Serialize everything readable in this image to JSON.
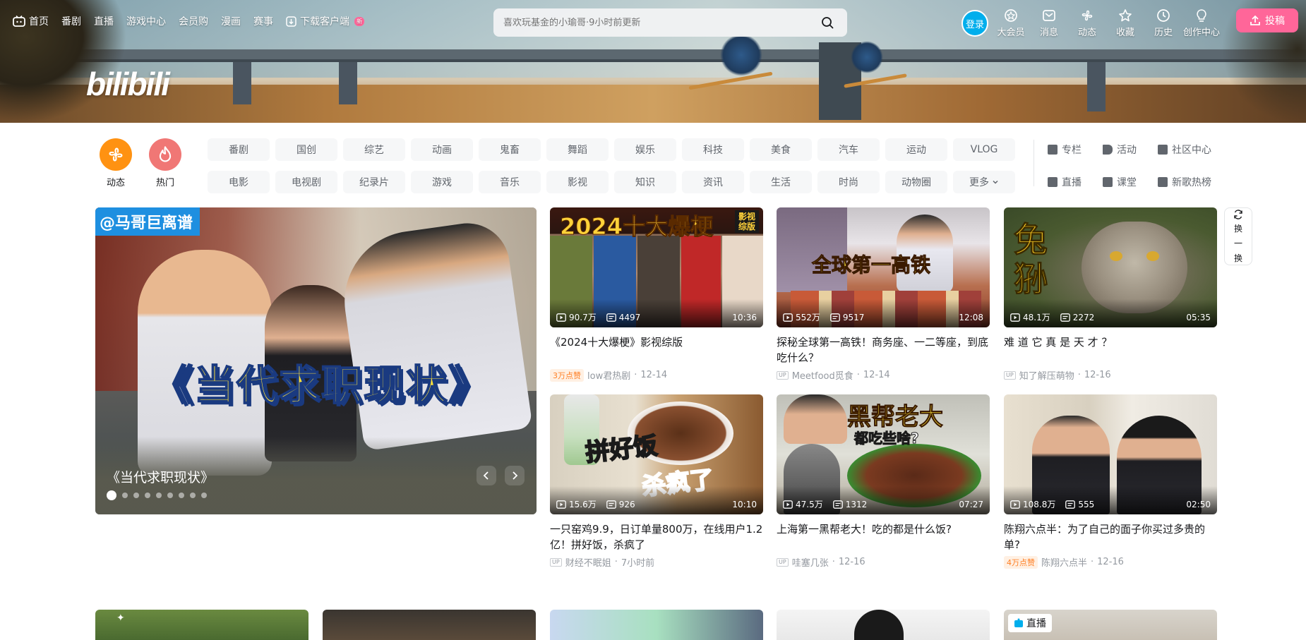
{
  "nav": {
    "left_items": [
      {
        "label": "首页",
        "icon": "tv-icon"
      },
      {
        "label": "番剧"
      },
      {
        "label": "直播"
      },
      {
        "label": "游戏中心"
      },
      {
        "label": "会员购"
      },
      {
        "label": "漫画"
      },
      {
        "label": "赛事"
      },
      {
        "label": "下载客户端",
        "icon": "download-icon",
        "badge": "新"
      }
    ],
    "search_placeholder": "喜欢玩基金的小瑜哥·9小时前更新",
    "login_label": "登录",
    "right_items": [
      {
        "label": "大会员",
        "icon": "vip-icon"
      },
      {
        "label": "消息",
        "icon": "message-icon"
      },
      {
        "label": "动态",
        "icon": "dynamic-icon"
      },
      {
        "label": "收藏",
        "icon": "star-icon"
      },
      {
        "label": "历史",
        "icon": "clock-icon"
      },
      {
        "label": "创作中心",
        "icon": "bulb-icon"
      }
    ],
    "upload_label": "投稿"
  },
  "logo": "bilibili",
  "channels": {
    "big": [
      {
        "label": "动态",
        "color": "#ff9212"
      },
      {
        "label": "热门",
        "color": "#f07775"
      }
    ],
    "grid": [
      "番剧",
      "国创",
      "综艺",
      "动画",
      "鬼畜",
      "舞蹈",
      "娱乐",
      "科技",
      "美食",
      "汽车",
      "运动",
      "VLOG",
      "电影",
      "电视剧",
      "纪录片",
      "游戏",
      "音乐",
      "影视",
      "知识",
      "资讯",
      "生活",
      "时尚",
      "动物圈",
      "更多"
    ],
    "side": [
      "专栏",
      "活动",
      "社区中心",
      "直播",
      "课堂",
      "新歌热榜"
    ]
  },
  "hero": {
    "tag": "@马哥巨离谱",
    "big_title": "《当代求职现状》",
    "caption": "《当代求职现状》",
    "dot_count": 9
  },
  "refresh": {
    "lines": [
      "换",
      "一",
      "换"
    ]
  },
  "cards": [
    {
      "views": "90.7万",
      "danmaku": "4497",
      "duration": "10:36",
      "title": "《2024十大爆梗》影视综版",
      "likes": "3万点赞",
      "author": "low君热剧",
      "date": "12-14",
      "thumb_text": "2024十大爆梗",
      "thumb_sub": "影视综版"
    },
    {
      "views": "552万",
      "danmaku": "9517",
      "duration": "12:08",
      "title": "探秘全球第一高铁！商务座、一二等座，到底吃什么？",
      "up": "UP",
      "author": "Meetfood觅食",
      "date": "12-14",
      "thumb_text": "全球第一高铁"
    },
    {
      "views": "48.1万",
      "danmaku": "2272",
      "duration": "05:35",
      "title": "难 道 它 真 是 天 才 ？",
      "up": "UP",
      "author": "知了解压萌物",
      "date": "12-16",
      "thumb_text": "兔狲"
    },
    {
      "views": "15.6万",
      "danmaku": "926",
      "duration": "10:10",
      "title": "一只窑鸡9.9，日订单量800万，在线用户1.2亿！拼好饭，杀疯了",
      "up": "UP",
      "author": "财经不眠姐",
      "date": "7小时前",
      "thumb_text": "拼好饭",
      "thumb_sub": "杀疯了"
    },
    {
      "views": "47.5万",
      "danmaku": "1312",
      "duration": "07:27",
      "title": "上海第一黑帮老大！吃的都是什么饭?",
      "up": "UP",
      "author": "哇塞几张",
      "date": "12-16",
      "thumb_text": "黑帮老大",
      "thumb_sub": "都吃些啥?"
    },
    {
      "views": "108.8万",
      "danmaku": "555",
      "duration": "02:50",
      "title": "陈翔六点半：为了自己的面子你买过多贵的单?",
      "likes": "4万点赞",
      "author": "陈翔六点半",
      "date": "12-16"
    }
  ],
  "bottom_row": {
    "live_label": "直播"
  }
}
